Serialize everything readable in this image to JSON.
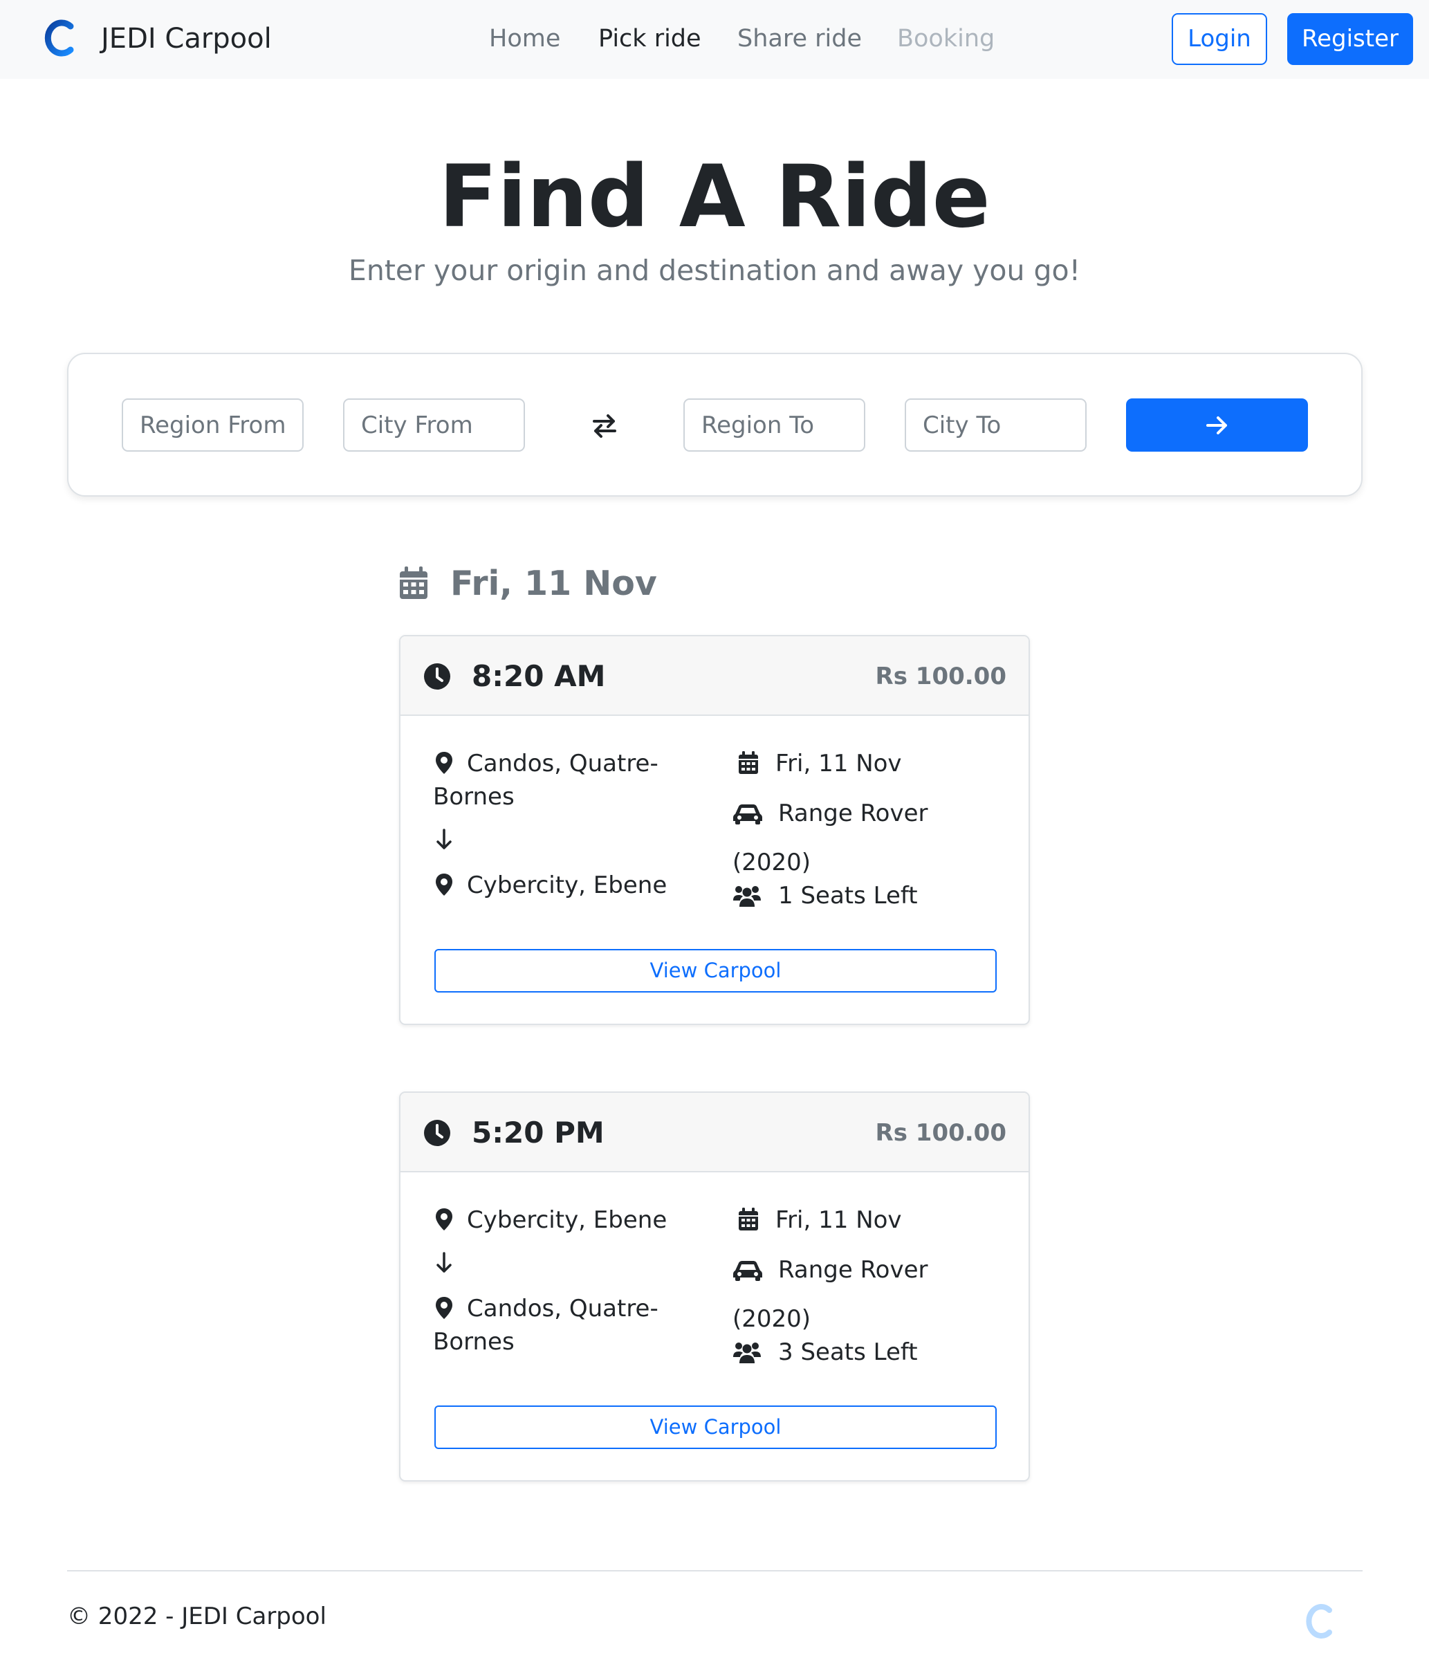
{
  "nav": {
    "brand": "JEDI Carpool",
    "links": [
      "Home",
      "Pick ride",
      "Share ride",
      "Booking"
    ],
    "login": "Login",
    "register": "Register"
  },
  "hero": {
    "title": "Find A Ride",
    "subtitle": "Enter your origin and destination and away you go!"
  },
  "search": {
    "region_from_placeholder": "Region From",
    "city_from_placeholder": "City From",
    "region_to_placeholder": "Region To",
    "city_to_placeholder": "City To",
    "swap_icon": "swap-arrows-icon",
    "submit_icon": "arrow-right-icon"
  },
  "date_heading": "Fri, 11 Nov",
  "rides": [
    {
      "time": "8:20 AM",
      "price": "Rs 100.00",
      "origin_line1": "Candos, Quatre-",
      "origin_line2": "Bornes",
      "destination": "Cybercity, Ebene",
      "date": "Fri, 11 Nov",
      "car_line1": "Range Rover",
      "car_line2": "(2020)",
      "seats": "1 Seats Left",
      "button": "View Carpool"
    },
    {
      "time": "5:20 PM",
      "price": "Rs 100.00",
      "origin": "Cybercity, Ebene",
      "destination_line1": "Candos, Quatre-",
      "destination_line2": "Bornes",
      "date": "Fri, 11 Nov",
      "car_line1": "Range Rover",
      "car_line2": "(2020)",
      "seats": "3 Seats Left",
      "button": "View Carpool"
    }
  ],
  "footer": {
    "copyright": "© 2022 - JEDI Carpool"
  },
  "colors": {
    "primary": "#0d6efd",
    "muted": "#6c757d",
    "navbar_bg": "#f8f9fa",
    "card_header_bg": "#f7f7f7"
  }
}
